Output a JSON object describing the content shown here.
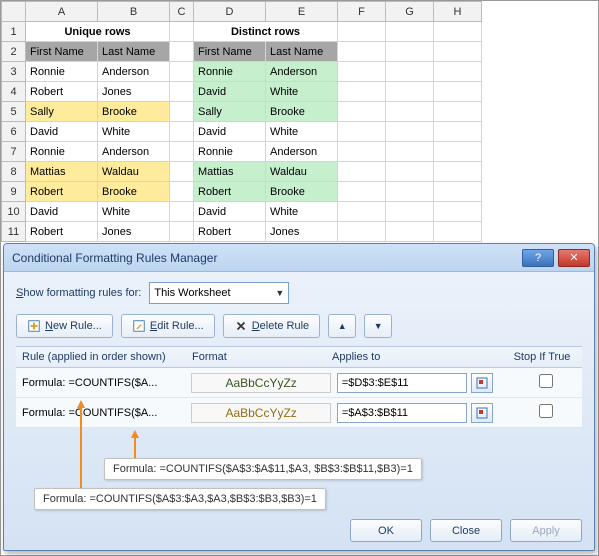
{
  "cols": [
    "A",
    "B",
    "C",
    "D",
    "E",
    "F",
    "G",
    "H"
  ],
  "section_titles": {
    "unique": "Unique rows",
    "distinct": "Distinct rows"
  },
  "hdr": {
    "first": "First Name",
    "last": "Last Name"
  },
  "rows": [
    {
      "A": "Ronnie",
      "B": "Anderson",
      "D": "Ronnie",
      "E": "Anderson",
      "hlA": null,
      "hlD": "green"
    },
    {
      "A": "Robert",
      "B": "Jones",
      "D": "David",
      "E": "White",
      "hlA": null,
      "hlD": "green"
    },
    {
      "A": "Sally",
      "B": "Brooke",
      "D": "Sally",
      "E": "Brooke",
      "hlA": "orange",
      "hlD": "green"
    },
    {
      "A": "David",
      "B": "White",
      "D": "David",
      "E": "White",
      "hlA": null,
      "hlD": null
    },
    {
      "A": "Ronnie",
      "B": "Anderson",
      "D": "Ronnie",
      "E": "Anderson",
      "hlA": null,
      "hlD": null
    },
    {
      "A": "Mattias",
      "B": "Waldau",
      "D": "Mattias",
      "E": "Waldau",
      "hlA": "orange",
      "hlD": "green"
    },
    {
      "A": "Robert",
      "B": "Brooke",
      "D": "Robert",
      "E": "Brooke",
      "hlA": "orange",
      "hlD": "green"
    },
    {
      "A": "David",
      "B": "White",
      "D": "David",
      "E": "White",
      "hlA": null,
      "hlD": null
    },
    {
      "A": "Robert",
      "B": "Jones",
      "D": "Robert",
      "E": "Jones",
      "hlA": null,
      "hlD": null
    }
  ],
  "dialog": {
    "title": "Conditional Formatting Rules Manager",
    "show_label": "Show formatting rules for:",
    "scope": "This Worksheet",
    "buttons": {
      "new": "New Rule...",
      "edit": "Edit Rule...",
      "delete": "Delete Rule"
    },
    "head": {
      "rule": "Rule (applied in order shown)",
      "format": "Format",
      "applies": "Applies to",
      "stop": "Stop If True"
    },
    "rules": [
      {
        "label": "Formula: =COUNTIFS($A...",
        "preview": "AaBbCcYyZz",
        "preview_class": "preview-green",
        "applies": "=$D$3:$E$11"
      },
      {
        "label": "Formula: =COUNTIFS($A...",
        "preview": "AaBbCcYyZz",
        "preview_class": "preview-orange",
        "applies": "=$A$3:$B$11"
      }
    ],
    "footer": {
      "ok": "OK",
      "close": "Close",
      "apply": "Apply"
    }
  },
  "callouts": {
    "c1": "Formula: =COUNTIFS($A$3:$A$11,$A3, $B$3:$B$11,$B3)=1",
    "c2": "Formula: =COUNTIFS($A$3:$A3,$A3,$B$3:$B3,$B3)=1"
  }
}
